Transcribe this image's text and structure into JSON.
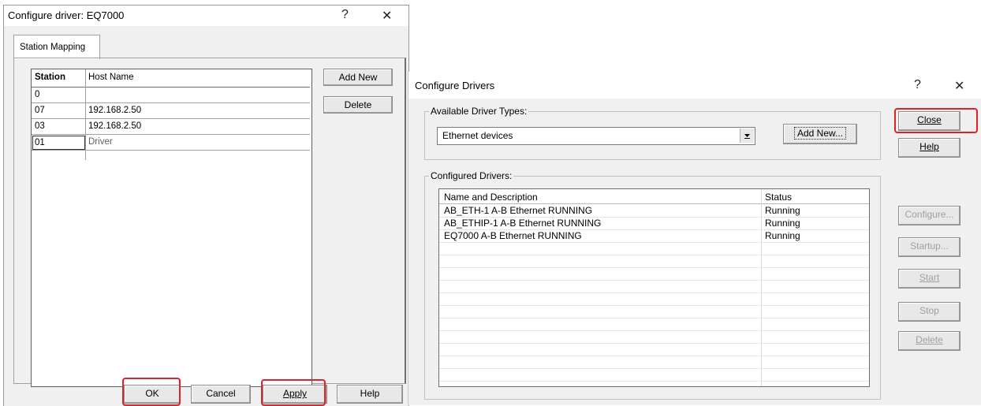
{
  "dialog1": {
    "title": "Configure driver: EQ7000",
    "help_glyph": "?",
    "close_glyph": "✕",
    "tab_label": "Station Mapping",
    "table": {
      "headers": [
        "Station",
        "Host Name"
      ],
      "rows": [
        {
          "station": "0",
          "host": ""
        },
        {
          "station": "07",
          "host": "192.168.2.50"
        },
        {
          "station": "03",
          "host": "192.168.2.50"
        },
        {
          "station": "01",
          "host": "Driver"
        }
      ]
    },
    "add_new_label": "Add New",
    "delete_label": "Delete",
    "ok_label": "OK",
    "cancel_label": "Cancel",
    "apply_label": "Apply",
    "help_label": "Help"
  },
  "dialog2": {
    "title": "Configure Drivers",
    "help_glyph": "?",
    "close_glyph": "✕",
    "available_group_label": "Available Driver Types:",
    "driver_type_selected": "Ethernet devices",
    "add_new_label": "Add New...",
    "configured_group_label": "Configured Drivers:",
    "list_headers": [
      "Name and Description",
      "Status"
    ],
    "list_rows": [
      {
        "name": "AB_ETH-1  A-B Ethernet  RUNNING",
        "status": "Running"
      },
      {
        "name": "AB_ETHIP-1  A-B Ethernet  RUNNING",
        "status": "Running"
      },
      {
        "name": "EQ7000  A-B Ethernet  RUNNING",
        "status": "Running"
      }
    ],
    "buttons": {
      "close": "Close",
      "help": "Help",
      "configure": "Configure...",
      "startup": "Startup...",
      "start": "Start",
      "stop": "Stop",
      "delete": "Delete"
    }
  },
  "colors": {
    "highlight": "#e0202a",
    "dialog_bg": "#f0f0f0",
    "disabled_text": "#a0a0a0"
  }
}
